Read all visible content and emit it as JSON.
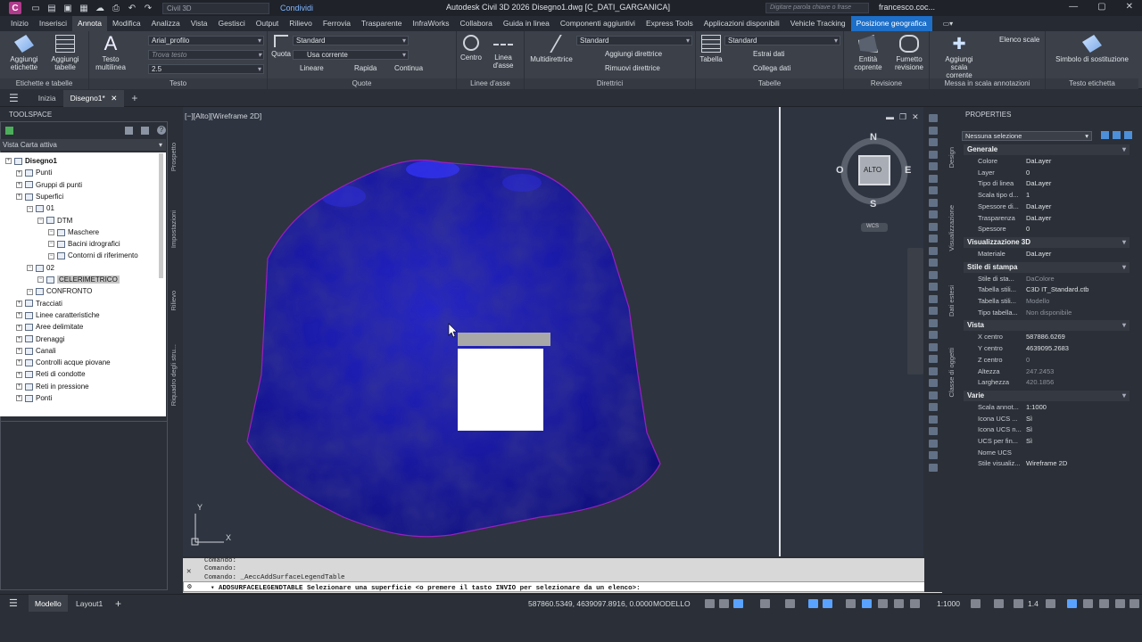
{
  "titlebar": {
    "app_letter": "C",
    "workspace": "Civil 3D",
    "share_label": "Condividi",
    "document_title": "Autodesk Civil 3D 2026   Disegno1.dwg [C_DATI_GARGANICA]",
    "search_placeholder": "Digitare parola chiave o frase",
    "user": "francesco.coc..."
  },
  "menu_tabs": [
    "Inizio",
    "Inserisci",
    "Annota",
    "Modifica",
    "Analizza",
    "Vista",
    "Gestisci",
    "Output",
    "Rilievo",
    "Ferrovia",
    "Trasparente",
    "InfraWorks",
    "Collabora",
    "Guida in linea",
    "Componenti aggiuntivi",
    "Express Tools",
    "Applicazioni disponibili",
    "Vehicle Tracking",
    "Posizione geografica"
  ],
  "ribbon": {
    "etichette": {
      "title": "Etichette e tabelle",
      "add_labels": "Aggiungi etichette",
      "add_tables": "Aggiungi tabelle"
    },
    "testo": {
      "title": "Testo",
      "multiline": "Testo multilinea",
      "font": "Arial_profilo",
      "find_placeholder": "Trova testo",
      "height": "2.5"
    },
    "quote": {
      "title": "Quote",
      "quota": "Quota",
      "style": "Standard",
      "layer": "Usa corrente",
      "linear": "Lineare",
      "quick": "Rapida",
      "continue": "Continua"
    },
    "linee_asse": {
      "title": "Linee d'asse",
      "center": "Centro",
      "axis_line": "Linea d'asse"
    },
    "direttrici": {
      "title": "Direttrici",
      "multi": "Multidirettrice",
      "style": "Standard",
      "add": "Aggiungi direttrice",
      "remove": "Rimuovi direttrice"
    },
    "tabelle": {
      "title": "Tabelle",
      "table": "Tabella",
      "style": "Standard",
      "extract": "Estrai dati",
      "link": "Collega dati"
    },
    "revisione": {
      "title": "Revisione",
      "entity": "Entità coprente",
      "cloud": "Fumetto revisione"
    },
    "scala": {
      "title": "Messa in scala annotazioni",
      "add_scale": "Aggiungi scala corrente",
      "list": "Elenco scale"
    },
    "testo_etichetta": {
      "title": "Testo etichetta",
      "symbol": "Simbolo di sostituzione"
    }
  },
  "doc_tabs": [
    "Inizia",
    "Disegno1*"
  ],
  "toolspace": {
    "title": "TOOLSPACE",
    "view": "Vista Carta attiva",
    "side_tabs": [
      "Prospetto",
      "Impostazioni",
      "Rilievo",
      "Riquadro degli stru..."
    ],
    "tree": [
      {
        "label": "Disegno1",
        "level": 0,
        "bold": true
      },
      {
        "label": "Punti",
        "level": 1
      },
      {
        "label": "Gruppi di punti",
        "level": 1
      },
      {
        "label": "Superfici",
        "level": 1
      },
      {
        "label": "01",
        "level": 2
      },
      {
        "label": "DTM",
        "level": 3
      },
      {
        "label": "Maschere",
        "level": 4
      },
      {
        "label": "Bacini idrografici",
        "level": 4
      },
      {
        "label": "Contorni di riferimento",
        "level": 4
      },
      {
        "label": "02",
        "level": 2
      },
      {
        "label": "CELERIMETRICO",
        "level": 3,
        "selected": true
      },
      {
        "label": "CONFRONTO",
        "level": 2
      },
      {
        "label": "Tracciati",
        "level": 1
      },
      {
        "label": "Linee caratteristiche",
        "level": 1
      },
      {
        "label": "Aree delimitate",
        "level": 1
      },
      {
        "label": "Drenaggi",
        "level": 1
      },
      {
        "label": "Canali",
        "level": 1
      },
      {
        "label": "Controlli acque piovane",
        "level": 1
      },
      {
        "label": "Reti di condotte",
        "level": 1
      },
      {
        "label": "Reti in pressione",
        "level": 1
      },
      {
        "label": "Ponti",
        "level": 1
      }
    ]
  },
  "viewport": {
    "label": "[−][Alto][Wireframe 2D]",
    "viewcube": {
      "n": "N",
      "s": "S",
      "e": "E",
      "w": "O",
      "face": "ALTO",
      "wcs": "WCS"
    },
    "ucs_x": "X",
    "ucs_y": "Y"
  },
  "command": {
    "history": [
      "Comando:",
      "Comando:",
      "Comando: _AeccAddSurfaceLegendTable"
    ],
    "prompt": "ADDSURFACELEGENDTABLE Selezionare una superficie <o premere il tasto INVIO per selezionare da un elenco>:"
  },
  "properties": {
    "title": "PROPERTIES",
    "selection": "Nessuna selezione",
    "side_tabs": [
      "Design",
      "Visualizzazione",
      "Dati estesi",
      "Classe di oggetti"
    ],
    "sections": [
      {
        "name": "Generale",
        "rows": [
          [
            "Colore",
            "DaLayer"
          ],
          [
            "Layer",
            "0"
          ],
          [
            "Tipo di linea",
            "DaLayer"
          ],
          [
            "Scala tipo d...",
            "1"
          ],
          [
            "Spessore di...",
            "DaLayer"
          ],
          [
            "Trasparenza",
            "DaLayer"
          ],
          [
            "Spessore",
            "0"
          ]
        ]
      },
      {
        "name": "Visualizzazione 3D",
        "rows": [
          [
            "Materiale",
            "DaLayer"
          ]
        ]
      },
      {
        "name": "Stile di stampa",
        "rows": [
          [
            "Stile di sta...",
            "DaColore"
          ],
          [
            "Tabella stili...",
            "C3D IT_Standard.ctb"
          ],
          [
            "Tabella stili...",
            "Modello"
          ],
          [
            "Tipo tabella...",
            "Non disponibile"
          ]
        ]
      },
      {
        "name": "Vista",
        "rows": [
          [
            "X centro",
            "587886.6269"
          ],
          [
            "Y centro",
            "4639095.2683"
          ],
          [
            "Z centro",
            "0"
          ],
          [
            "Altezza",
            "247.2453"
          ],
          [
            "Larghezza",
            "420.1856"
          ]
        ]
      },
      {
        "name": "Varie",
        "rows": [
          [
            "Scala annot...",
            "1:1000"
          ],
          [
            "Icona UCS ...",
            "Sì"
          ],
          [
            "Icona UCS n...",
            "Sì"
          ],
          [
            "UCS per fin...",
            "Sì"
          ],
          [
            "Nome UCS",
            ""
          ],
          [
            "Stile visualiz...",
            "Wireframe 2D"
          ]
        ]
      }
    ]
  },
  "status": {
    "tabs": [
      "Modello",
      "Layout1"
    ],
    "coords": "587860.5349, 4639097.8916, 0.0000",
    "space": "MODELLO",
    "scale": "1:1000",
    "lw": "1.4"
  },
  "colors": {
    "surface": "#1818a0",
    "accent": "#1d6fc8"
  }
}
